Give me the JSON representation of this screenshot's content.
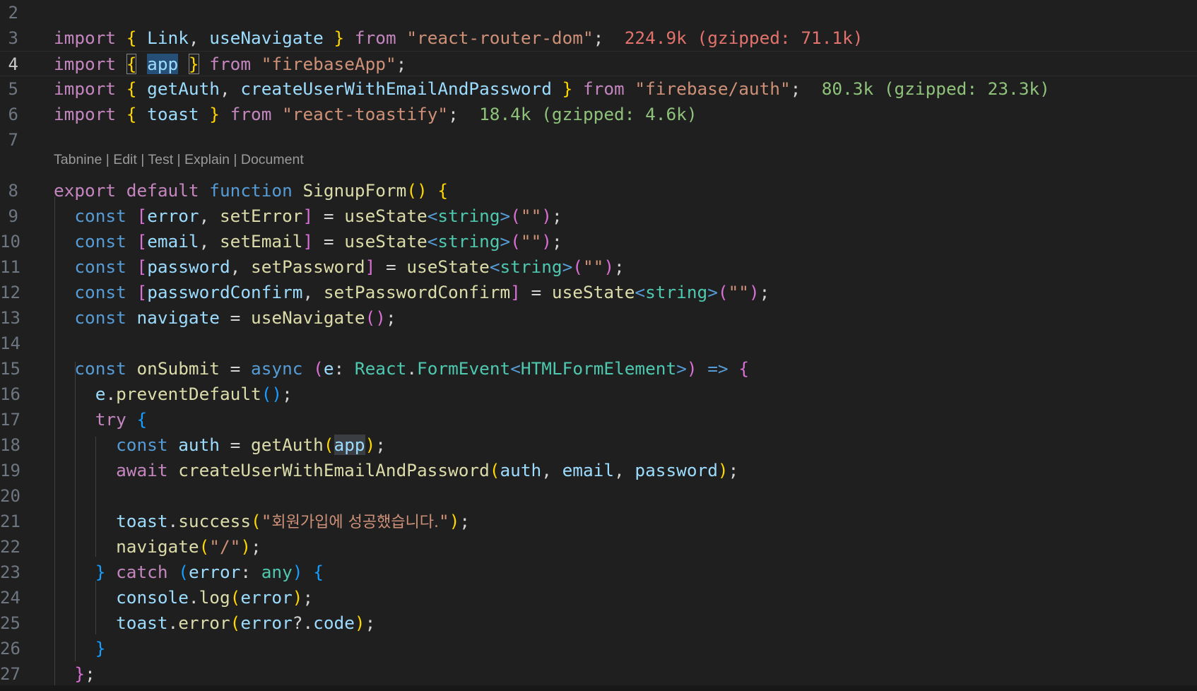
{
  "editor": {
    "active_line": "4",
    "code_lens": "Tabnine | Edit | Test | Explain | Document",
    "lines": [
      {
        "n": "2",
        "tokens": []
      },
      {
        "n": "3",
        "tokens": [
          [
            "kw",
            "import"
          ],
          [
            "txt",
            " "
          ],
          [
            "p1",
            "{"
          ],
          [
            "txt",
            " "
          ],
          [
            "var",
            "Link"
          ],
          [
            "txt",
            ", "
          ],
          [
            "var",
            "useNavigate"
          ],
          [
            "txt",
            " "
          ],
          [
            "p1",
            "}"
          ],
          [
            "txt",
            " "
          ],
          [
            "kw",
            "from"
          ],
          [
            "txt",
            " "
          ],
          [
            "str",
            "\"react-router-dom\""
          ],
          [
            "txt",
            ";  "
          ],
          [
            "sz-red",
            "224.9k (gzipped: 71.1k)"
          ]
        ]
      },
      {
        "n": "4",
        "tokens": [
          [
            "kw",
            "import"
          ],
          [
            "txt",
            " "
          ],
          [
            "p1 bm",
            "{"
          ],
          [
            "txt",
            " "
          ],
          [
            "var sel",
            "app"
          ],
          [
            "txt",
            " "
          ],
          [
            "p1 bm",
            "}"
          ],
          [
            "txt",
            " "
          ],
          [
            "kw",
            "from"
          ],
          [
            "txt",
            " "
          ],
          [
            "str",
            "\"firebaseApp\""
          ],
          [
            "txt",
            ";"
          ]
        ]
      },
      {
        "n": "5",
        "tokens": [
          [
            "kw",
            "import"
          ],
          [
            "txt",
            " "
          ],
          [
            "p1",
            "{"
          ],
          [
            "txt",
            " "
          ],
          [
            "var",
            "getAuth"
          ],
          [
            "txt",
            ", "
          ],
          [
            "var",
            "createUserWithEmailAndPassword"
          ],
          [
            "txt",
            " "
          ],
          [
            "p1",
            "}"
          ],
          [
            "txt",
            " "
          ],
          [
            "kw",
            "from"
          ],
          [
            "txt",
            " "
          ],
          [
            "str",
            "\"firebase/auth\""
          ],
          [
            "txt",
            ";  "
          ],
          [
            "sz-green",
            "80.3k (gzipped: 23.3k)"
          ]
        ]
      },
      {
        "n": "6",
        "tokens": [
          [
            "kw",
            "import"
          ],
          [
            "txt",
            " "
          ],
          [
            "p1",
            "{"
          ],
          [
            "txt",
            " "
          ],
          [
            "var",
            "toast"
          ],
          [
            "txt",
            " "
          ],
          [
            "p1",
            "}"
          ],
          [
            "txt",
            " "
          ],
          [
            "kw",
            "from"
          ],
          [
            "txt",
            " "
          ],
          [
            "str",
            "\"react-toastify\""
          ],
          [
            "txt",
            ";  "
          ],
          [
            "sz-green",
            "18.4k (gzipped: 4.6k)"
          ]
        ]
      },
      {
        "n": "7",
        "tokens": []
      },
      {
        "n": "8",
        "tokens": [
          [
            "kw",
            "export"
          ],
          [
            "txt",
            " "
          ],
          [
            "kw",
            "default"
          ],
          [
            "txt",
            " "
          ],
          [
            "kwb",
            "function"
          ],
          [
            "txt",
            " "
          ],
          [
            "fn",
            "SignupForm"
          ],
          [
            "p1",
            "()"
          ],
          [
            "txt",
            " "
          ],
          [
            "p1",
            "{"
          ]
        ]
      },
      {
        "n": "9",
        "tokens": [
          [
            "txt",
            "  "
          ],
          [
            "kwb",
            "const"
          ],
          [
            "txt",
            " "
          ],
          [
            "p2",
            "["
          ],
          [
            "var",
            "error"
          ],
          [
            "txt",
            ", "
          ],
          [
            "fn",
            "setError"
          ],
          [
            "p2",
            "]"
          ],
          [
            "txt",
            " = "
          ],
          [
            "fn",
            "useState"
          ],
          [
            "kwb",
            "<"
          ],
          [
            "typ",
            "string"
          ],
          [
            "kwb",
            ">"
          ],
          [
            "p2",
            "("
          ],
          [
            "str",
            "\"\""
          ],
          [
            "p2",
            ")"
          ],
          [
            "txt",
            ";"
          ]
        ]
      },
      {
        "n": "10",
        "tokens": [
          [
            "txt",
            "  "
          ],
          [
            "kwb",
            "const"
          ],
          [
            "txt",
            " "
          ],
          [
            "p2",
            "["
          ],
          [
            "var",
            "email"
          ],
          [
            "txt",
            ", "
          ],
          [
            "fn",
            "setEmail"
          ],
          [
            "p2",
            "]"
          ],
          [
            "txt",
            " = "
          ],
          [
            "fn",
            "useState"
          ],
          [
            "kwb",
            "<"
          ],
          [
            "typ",
            "string"
          ],
          [
            "kwb",
            ">"
          ],
          [
            "p2",
            "("
          ],
          [
            "str",
            "\"\""
          ],
          [
            "p2",
            ")"
          ],
          [
            "txt",
            ";"
          ]
        ]
      },
      {
        "n": "11",
        "tokens": [
          [
            "txt",
            "  "
          ],
          [
            "kwb",
            "const"
          ],
          [
            "txt",
            " "
          ],
          [
            "p2",
            "["
          ],
          [
            "var",
            "password"
          ],
          [
            "txt",
            ", "
          ],
          [
            "fn",
            "setPassword"
          ],
          [
            "p2",
            "]"
          ],
          [
            "txt",
            " = "
          ],
          [
            "fn",
            "useState"
          ],
          [
            "kwb",
            "<"
          ],
          [
            "typ",
            "string"
          ],
          [
            "kwb",
            ">"
          ],
          [
            "p2",
            "("
          ],
          [
            "str",
            "\"\""
          ],
          [
            "p2",
            ")"
          ],
          [
            "txt",
            ";"
          ]
        ]
      },
      {
        "n": "12",
        "tokens": [
          [
            "txt",
            "  "
          ],
          [
            "kwb",
            "const"
          ],
          [
            "txt",
            " "
          ],
          [
            "p2",
            "["
          ],
          [
            "var",
            "passwordConfirm"
          ],
          [
            "txt",
            ", "
          ],
          [
            "fn",
            "setPasswordConfirm"
          ],
          [
            "p2",
            "]"
          ],
          [
            "txt",
            " = "
          ],
          [
            "fn",
            "useState"
          ],
          [
            "kwb",
            "<"
          ],
          [
            "typ",
            "string"
          ],
          [
            "kwb",
            ">"
          ],
          [
            "p2",
            "("
          ],
          [
            "str",
            "\"\""
          ],
          [
            "p2",
            ")"
          ],
          [
            "txt",
            ";"
          ]
        ]
      },
      {
        "n": "13",
        "tokens": [
          [
            "txt",
            "  "
          ],
          [
            "kwb",
            "const"
          ],
          [
            "txt",
            " "
          ],
          [
            "var",
            "navigate"
          ],
          [
            "txt",
            " = "
          ],
          [
            "fn",
            "useNavigate"
          ],
          [
            "p2",
            "()"
          ],
          [
            "txt",
            ";"
          ]
        ]
      },
      {
        "n": "14",
        "tokens": []
      },
      {
        "n": "15",
        "tokens": [
          [
            "txt",
            "  "
          ],
          [
            "kwb",
            "const"
          ],
          [
            "txt",
            " "
          ],
          [
            "fn",
            "onSubmit"
          ],
          [
            "txt",
            " = "
          ],
          [
            "kwb",
            "async"
          ],
          [
            "txt",
            " "
          ],
          [
            "p2",
            "("
          ],
          [
            "var",
            "e"
          ],
          [
            "txt",
            ": "
          ],
          [
            "typ",
            "React"
          ],
          [
            "txt",
            "."
          ],
          [
            "typ",
            "FormEvent"
          ],
          [
            "kwb",
            "<"
          ],
          [
            "typ",
            "HTMLFormElement"
          ],
          [
            "kwb",
            ">"
          ],
          [
            "p2",
            ")"
          ],
          [
            "txt",
            " "
          ],
          [
            "kwb",
            "=>"
          ],
          [
            "txt",
            " "
          ],
          [
            "p2",
            "{"
          ]
        ]
      },
      {
        "n": "16",
        "tokens": [
          [
            "txt",
            "    "
          ],
          [
            "var",
            "e"
          ],
          [
            "txt",
            "."
          ],
          [
            "fn",
            "preventDefault"
          ],
          [
            "p3",
            "()"
          ],
          [
            "txt",
            ";"
          ]
        ]
      },
      {
        "n": "17",
        "tokens": [
          [
            "txt",
            "    "
          ],
          [
            "kw",
            "try"
          ],
          [
            "txt",
            " "
          ],
          [
            "p3",
            "{"
          ]
        ]
      },
      {
        "n": "18",
        "tokens": [
          [
            "txt",
            "      "
          ],
          [
            "kwb",
            "const"
          ],
          [
            "txt",
            " "
          ],
          [
            "var",
            "auth"
          ],
          [
            "txt",
            " = "
          ],
          [
            "fn",
            "getAuth"
          ],
          [
            "p1",
            "("
          ],
          [
            "var hl",
            "app"
          ],
          [
            "p1",
            ")"
          ],
          [
            "txt",
            ";"
          ]
        ]
      },
      {
        "n": "19",
        "tokens": [
          [
            "txt",
            "      "
          ],
          [
            "kw",
            "await"
          ],
          [
            "txt",
            " "
          ],
          [
            "fn",
            "createUserWithEmailAndPassword"
          ],
          [
            "p1",
            "("
          ],
          [
            "var",
            "auth"
          ],
          [
            "txt",
            ", "
          ],
          [
            "var",
            "email"
          ],
          [
            "txt",
            ", "
          ],
          [
            "var",
            "password"
          ],
          [
            "p1",
            ")"
          ],
          [
            "txt",
            ";"
          ]
        ]
      },
      {
        "n": "20",
        "tokens": []
      },
      {
        "n": "21",
        "tokens": [
          [
            "txt",
            "      "
          ],
          [
            "var",
            "toast"
          ],
          [
            "txt",
            "."
          ],
          [
            "fn",
            "success"
          ],
          [
            "p1",
            "("
          ],
          [
            "str",
            "\""
          ],
          [
            "str fnt",
            "회원가입에 성공했습니다."
          ],
          [
            "str",
            "\""
          ],
          [
            "p1",
            ")"
          ],
          [
            "txt",
            ";"
          ]
        ]
      },
      {
        "n": "22",
        "tokens": [
          [
            "txt",
            "      "
          ],
          [
            "fn",
            "navigate"
          ],
          [
            "p1",
            "("
          ],
          [
            "str",
            "\"/\""
          ],
          [
            "p1",
            ")"
          ],
          [
            "txt",
            ";"
          ]
        ]
      },
      {
        "n": "23",
        "tokens": [
          [
            "txt",
            "    "
          ],
          [
            "p3",
            "}"
          ],
          [
            "txt",
            " "
          ],
          [
            "kw",
            "catch"
          ],
          [
            "txt",
            " "
          ],
          [
            "p3",
            "("
          ],
          [
            "var",
            "error"
          ],
          [
            "txt",
            ": "
          ],
          [
            "typ",
            "any"
          ],
          [
            "p3",
            ")"
          ],
          [
            "txt",
            " "
          ],
          [
            "p3",
            "{"
          ]
        ]
      },
      {
        "n": "24",
        "tokens": [
          [
            "txt",
            "      "
          ],
          [
            "var",
            "console"
          ],
          [
            "txt",
            "."
          ],
          [
            "fn",
            "log"
          ],
          [
            "p1",
            "("
          ],
          [
            "var",
            "error"
          ],
          [
            "p1",
            ")"
          ],
          [
            "txt",
            ";"
          ]
        ]
      },
      {
        "n": "25",
        "tokens": [
          [
            "txt",
            "      "
          ],
          [
            "var",
            "toast"
          ],
          [
            "txt",
            "."
          ],
          [
            "fn",
            "error"
          ],
          [
            "p1",
            "("
          ],
          [
            "var",
            "error"
          ],
          [
            "txt",
            "?."
          ],
          [
            "var",
            "code"
          ],
          [
            "p1",
            ")"
          ],
          [
            "txt",
            ";"
          ]
        ]
      },
      {
        "n": "26",
        "tokens": [
          [
            "txt",
            "    "
          ],
          [
            "p3",
            "}"
          ]
        ]
      },
      {
        "n": "27",
        "tokens": [
          [
            "txt",
            "  "
          ],
          [
            "p2",
            "}"
          ],
          [
            "txt",
            ";"
          ]
        ]
      }
    ]
  },
  "colors": {
    "background": "#1f1f1f",
    "keyword_control": "#c586c0",
    "keyword_storage": "#569cd6",
    "variable": "#9cdcfe",
    "function": "#dcdcaa",
    "string": "#ce9178",
    "type": "#4ec9b0",
    "bracket_1": "#ffd700",
    "bracket_2": "#da70d6",
    "bracket_3": "#179fff",
    "import_cost_large": "#e2726c",
    "import_cost_small": "#8fc27a"
  }
}
